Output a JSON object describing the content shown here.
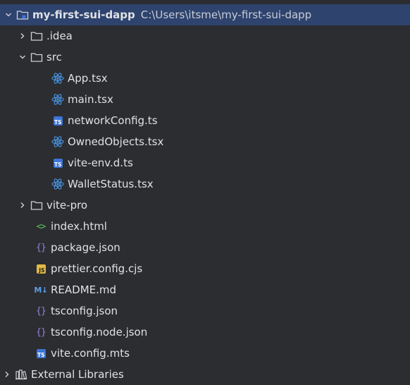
{
  "project": {
    "name": "my-first-sui-dapp",
    "path": "C:\\Users\\itsme\\my-first-sui-dapp"
  },
  "tree": {
    "idea_folder": ".idea",
    "src_folder": "src",
    "src_files": {
      "app": "App.tsx",
      "main": "main.tsx",
      "network_config": "networkConfig.ts",
      "owned_objects": "OwnedObjects.tsx",
      "vite_env": "vite-env.d.ts",
      "wallet_status": "WalletStatus.tsx"
    },
    "vite_pro_folder": "vite-pro",
    "root_files": {
      "index_html": "index.html",
      "package_json": "package.json",
      "prettier_config": "prettier.config.cjs",
      "readme": "README.md",
      "tsconfig": "tsconfig.json",
      "tsconfig_node": "tsconfig.node.json",
      "vite_config": "vite.config.mts"
    },
    "external_libraries": "External Libraries"
  },
  "icons": {
    "ts_badge": "TS",
    "js_badge": "JS",
    "json_braces": "{}",
    "markdown": "M↓",
    "html_brackets": "<>"
  },
  "colors": {
    "background": "#2b2d30",
    "selection": "#2e436e",
    "react": "#4a8fd9",
    "ts_badge": "#3d74d6",
    "js_badge": "#e1b945",
    "json": "#9b7fdc",
    "html": "#58a55c"
  }
}
